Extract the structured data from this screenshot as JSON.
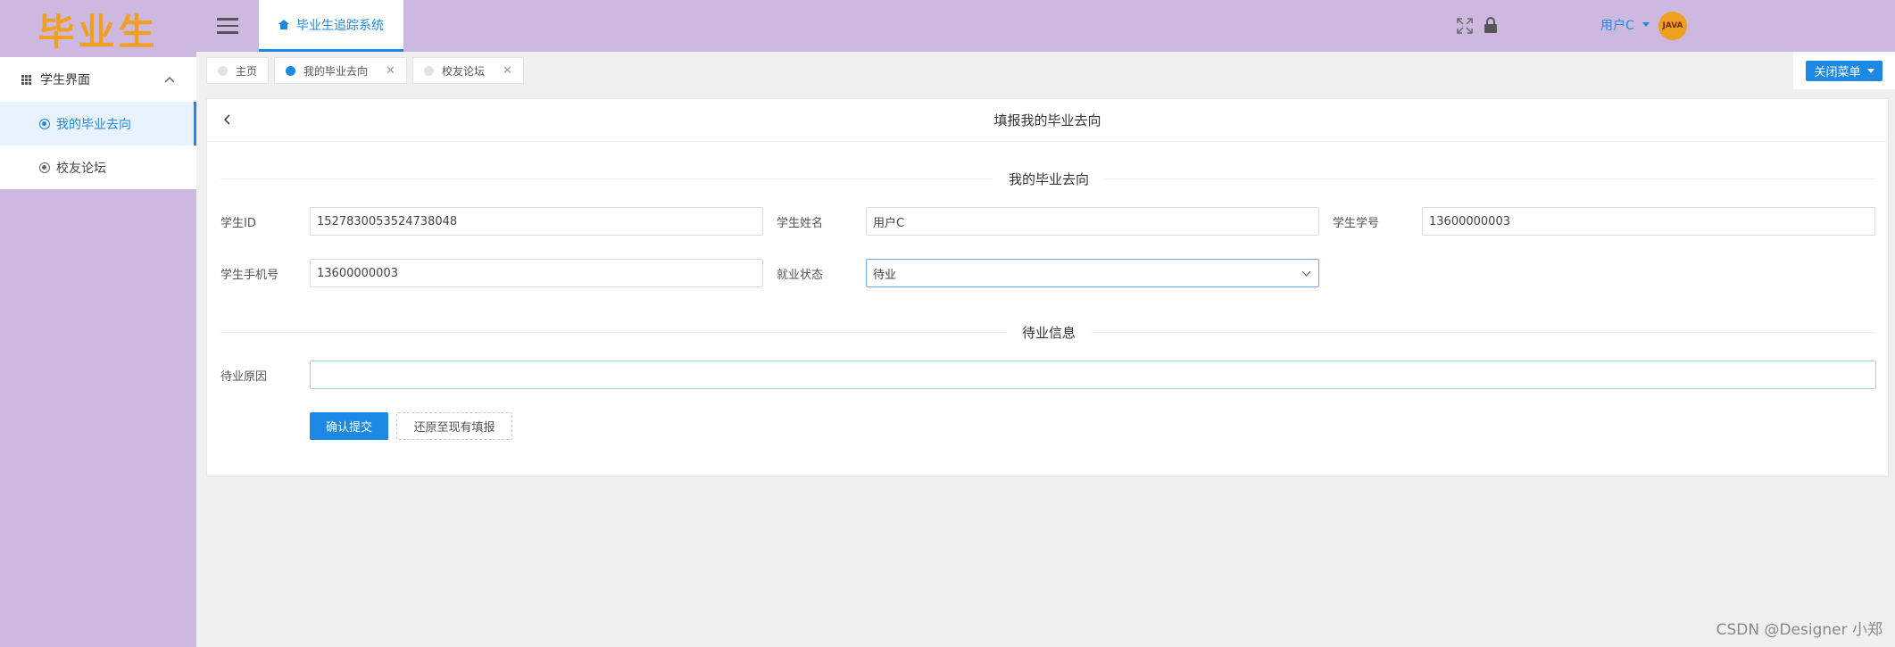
{
  "sidebar": {
    "logo": "毕业生",
    "group": {
      "label": "学生界面"
    },
    "items": [
      {
        "label": "我的毕业去向",
        "active": true
      },
      {
        "label": "校友论坛",
        "active": false
      }
    ]
  },
  "header": {
    "app_tab": "毕业生追踪系统",
    "user": "用户C",
    "avatar_text": "JAVA"
  },
  "tabs": [
    {
      "label": "主页",
      "active": false,
      "closable": false
    },
    {
      "label": "我的毕业去向",
      "active": true,
      "closable": true
    },
    {
      "label": "校友论坛",
      "active": false,
      "closable": true
    }
  ],
  "close_menu": "关闭菜单",
  "card": {
    "title": "填报我的毕业去向",
    "section1": "我的毕业去向",
    "section2": "待业信息",
    "fields": {
      "student_id": {
        "label": "学生ID",
        "value": "1527830053524738048"
      },
      "student_name": {
        "label": "学生姓名",
        "value": "用户C"
      },
      "student_no": {
        "label": "学生学号",
        "value": "13600000003"
      },
      "student_phone": {
        "label": "学生手机号",
        "value": "13600000003"
      },
      "job_status": {
        "label": "就业状态",
        "value": "待业"
      },
      "unemployed_reason": {
        "label": "待业原因",
        "value": ""
      }
    },
    "submit": "确认提交",
    "restore": "还原至现有填报"
  },
  "watermark": "CSDN @Designer 小郑",
  "colors": {
    "accent": "#1e88e5",
    "sidebar": "#cdb8e0",
    "logo": "#f0a020"
  }
}
